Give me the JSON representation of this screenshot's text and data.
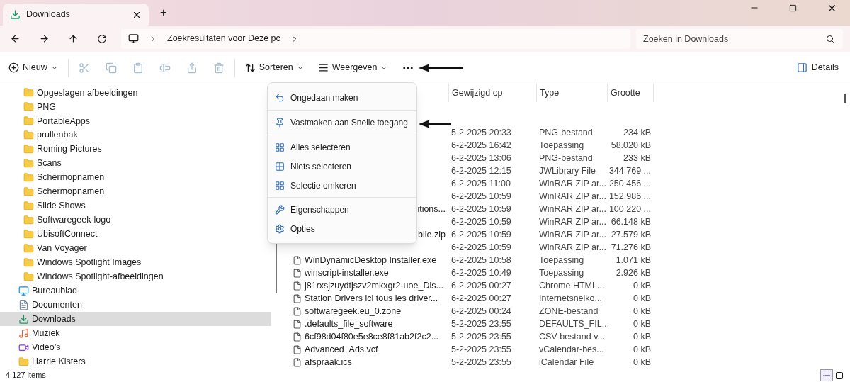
{
  "window": {
    "tab_title": "Downloads",
    "new_tab": "+"
  },
  "address_bar": {
    "crumb": "Zoekresultaten voor Deze pc"
  },
  "search": {
    "placeholder": "Zoeken in Downloads"
  },
  "toolbar": {
    "new": "Nieuw",
    "icon_buttons": [
      {
        "disabled": true
      },
      {
        "disabled": true
      },
      {
        "disabled": true
      },
      {
        "disabled": true
      },
      {
        "disabled": true
      },
      {
        "disabled": true
      }
    ],
    "sort": "Sorteren",
    "view": "Weergeven",
    "details": "Details"
  },
  "context_menu": {
    "groups": [
      [
        {
          "label": "Ongedaan maken"
        }
      ],
      [
        {
          "label": "Vastmaken aan Snelle toegang"
        }
      ],
      [
        {
          "label": "Alles selecteren"
        },
        {
          "label": "Niets selecteren"
        },
        {
          "label": "Selectie omkeren"
        }
      ],
      [
        {
          "label": "Eigenschappen"
        },
        {
          "label": "Opties"
        }
      ]
    ]
  },
  "sidebar": {
    "subfolders": [
      {
        "label": "Opgeslagen afbeeldingen",
        "selected": false
      },
      {
        "label": "PNG",
        "selected": false
      },
      {
        "label": "PortableApps",
        "selected": false
      },
      {
        "label": "prullenbak",
        "selected": false
      },
      {
        "label": "Roming Pictures",
        "selected": false
      },
      {
        "label": "Scans",
        "selected": false
      },
      {
        "label": "Schermopnamen",
        "selected": false
      },
      {
        "label": "Schermopnamen",
        "selected": false
      },
      {
        "label": "Slide Shows",
        "selected": false
      },
      {
        "label": "Softwaregeek-logo",
        "selected": false
      },
      {
        "label": "UbisoftConnect",
        "selected": false
      },
      {
        "label": "Van Voyager",
        "selected": false
      },
      {
        "label": "Windows Spotlight Images",
        "selected": false
      },
      {
        "label": "Windows Spotlight-afbeeldingen",
        "selected": false
      }
    ],
    "items": [
      {
        "kind": "desktop",
        "label": "Bureaublad",
        "selected": false
      },
      {
        "kind": "documents",
        "label": "Documenten",
        "selected": false
      },
      {
        "kind": "downloads",
        "label": "Downloads",
        "selected": true
      },
      {
        "kind": "music",
        "label": "Muziek",
        "selected": false
      },
      {
        "kind": "videos",
        "label": "Video’s",
        "selected": false
      },
      {
        "kind": "folder",
        "label": "Harrie Kisters",
        "selected": false
      }
    ]
  },
  "table": {
    "columns": [
      "Gewijzigd op",
      "Type",
      "Grootte"
    ],
    "rows": [
      {
        "modified": "5-2-2025 20:33",
        "type": "PNG-bestand",
        "size": "234 kB"
      },
      {
        "modified": "6-2-2025 16:42",
        "type": "Toepassing",
        "size": "58.020 kB"
      },
      {
        "modified": "6-2-2025 13:06",
        "type": "PNG-bestand",
        "size": "233 kB"
      },
      {
        "modified": "6-2-2025 12:15",
        "type": "JWLibrary File",
        "size": "344.769 ..."
      },
      {
        "modified": "6-2-2025 11:00",
        "type": "WinRAR ZIP ar...",
        "size": "250.456 ..."
      },
      {
        "modified": "6-2-2025 10:59",
        "type": "WinRAR ZIP ar...",
        "size": "152.986 ..."
      },
      {
        "name": "itions...",
        "partial": true,
        "modified": "6-2-2025 10:59",
        "type": "WinRAR ZIP ar...",
        "size": "100.220 ..."
      },
      {
        "modified": "6-2-2025 10:59",
        "type": "WinRAR ZIP ar...",
        "size": "66.148 kB"
      },
      {
        "name": "bile.zip",
        "partial": true,
        "modified": "6-2-2025 10:59",
        "type": "WinRAR ZIP ar...",
        "size": "27.579 kB"
      },
      {
        "modified": "6-2-2025 10:59",
        "type": "WinRAR ZIP ar...",
        "size": "71.276 kB"
      },
      {
        "name": "WinDynamicDesktop Installer.exe",
        "modified": "6-2-2025 10:58",
        "type": "Toepassing",
        "size": "1.071 kB"
      },
      {
        "name": "winscript-installer.exe",
        "modified": "6-2-2025 10:49",
        "type": "Toepassing",
        "size": "2.926 kB"
      },
      {
        "name": "j81rxsjzuydtjszv2mkxgr2-uoe_Dis...",
        "modified": "6-2-2025 00:27",
        "type": "Chrome HTML...",
        "size": "0 kB"
      },
      {
        "name": "Station Drivers ici tous les driver...",
        "modified": "6-2-2025 00:27",
        "type": "Internetsnelko...",
        "size": "0 kB"
      },
      {
        "name": "softwaregeek.eu_0.zone",
        "modified": "6-2-2025 00:24",
        "type": "ZONE-bestand",
        "size": "0 kB"
      },
      {
        "name": ".defaults_file_software",
        "modified": "5-2-2025 23:55",
        "type": "DEFAULTS_FIL...",
        "size": "0 kB"
      },
      {
        "name": "6cf98d04f80e5e8ce8f81ab2f2c2...",
        "modified": "5-2-2025 23:55",
        "type": "CSV-bestand v...",
        "size": "0 kB"
      },
      {
        "name": "Advanced_Ads.vcf",
        "modified": "5-2-2025 23:55",
        "type": "vCalendar-bes...",
        "size": "0 kB"
      },
      {
        "name": "afspraak.ics",
        "modified": "5-2-2025 23:55",
        "type": "iCalendar File",
        "size": "0 kB"
      }
    ]
  },
  "status_bar": {
    "count": "4.127 items",
    "views": [
      {
        "selected": true
      },
      {
        "selected": false
      }
    ]
  }
}
